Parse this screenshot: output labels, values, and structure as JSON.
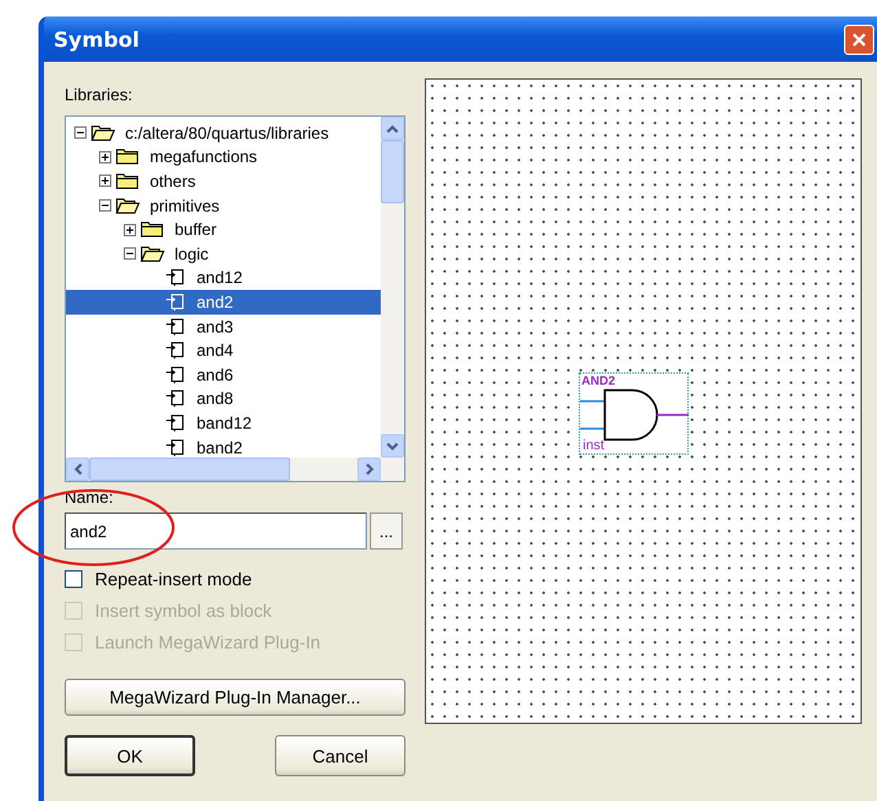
{
  "window": {
    "title": "Symbol"
  },
  "libraries": {
    "label": "Libraries:",
    "tree": [
      {
        "label": "c:/altera/80/quartus/libraries",
        "kind": "folder",
        "expanded": true,
        "selected": false,
        "children": [
          {
            "label": "megafunctions",
            "kind": "folder",
            "expanded": false,
            "selected": false
          },
          {
            "label": "others",
            "kind": "folder",
            "expanded": false,
            "selected": false
          },
          {
            "label": "primitives",
            "kind": "folder",
            "expanded": true,
            "selected": false,
            "children": [
              {
                "label": "buffer",
                "kind": "folder",
                "expanded": false,
                "selected": false
              },
              {
                "label": "logic",
                "kind": "folder",
                "expanded": true,
                "selected": false,
                "children": [
                  {
                    "label": "and12",
                    "kind": "symbol",
                    "selected": false
                  },
                  {
                    "label": "and2",
                    "kind": "symbol",
                    "selected": true
                  },
                  {
                    "label": "and3",
                    "kind": "symbol",
                    "selected": false
                  },
                  {
                    "label": "and4",
                    "kind": "symbol",
                    "selected": false
                  },
                  {
                    "label": "and6",
                    "kind": "symbol",
                    "selected": false
                  },
                  {
                    "label": "and8",
                    "kind": "symbol",
                    "selected": false
                  },
                  {
                    "label": "band12",
                    "kind": "symbol",
                    "selected": false
                  },
                  {
                    "label": "band2",
                    "kind": "symbol",
                    "selected": false
                  }
                ]
              }
            ]
          }
        ]
      }
    ]
  },
  "name": {
    "label": "Name:",
    "value": "and2",
    "browse": "..."
  },
  "options": [
    {
      "label": "Repeat-insert mode",
      "checked": false,
      "disabled": false
    },
    {
      "label": "Insert symbol as block",
      "checked": false,
      "disabled": true
    },
    {
      "label": "Launch MegaWizard Plug-In",
      "checked": false,
      "disabled": true
    }
  ],
  "wizard_button": "MegaWizard Plug-In Manager...",
  "buttons": [
    {
      "label": "OK",
      "default": true
    },
    {
      "label": "Cancel",
      "default": false
    }
  ],
  "preview": {
    "symbol": "AND2",
    "instance": "inst"
  }
}
